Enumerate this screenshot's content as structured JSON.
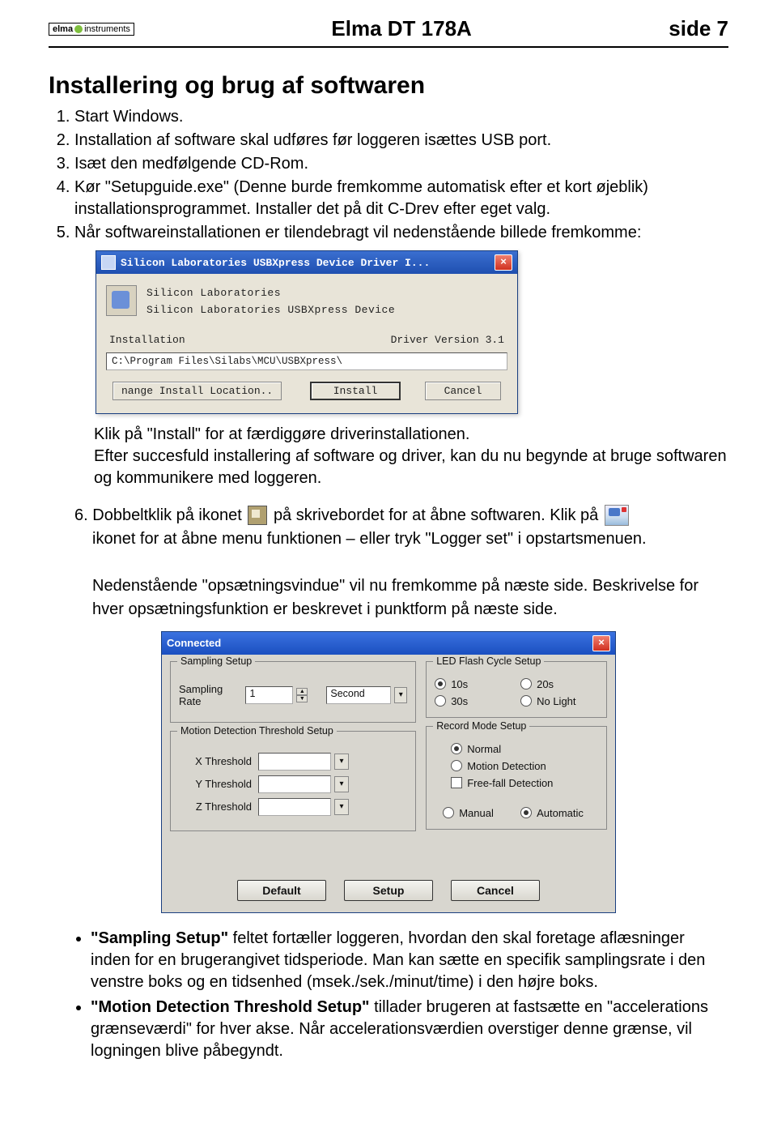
{
  "header": {
    "logo_text_left": "elma",
    "logo_text_right": "instruments",
    "title": "Elma DT 178A",
    "side": "side 7"
  },
  "section_title": "Installering og brug af softwaren",
  "steps": [
    "Start Windows.",
    "Installation af software skal udføres før loggeren isættes USB port.",
    "Isæt den medfølgende CD-Rom.",
    "Kør \"Setupguide.exe\" (Denne burde fremkomme automatisk efter et kort øjeblik) installationsprogrammet. Installer det på dit C-Drev efter eget valg.",
    "Når softwareinstallationen er tilendebragt vil nedenstående billede fremkomme:"
  ],
  "installer": {
    "title": "Silicon Laboratories USBXpress Device Driver I...",
    "line1": "Silicon Laboratories",
    "line2": "Silicon Laboratories USBXpress Device",
    "install_label": "Installation",
    "driver_version": "Driver Version 3.1",
    "path": "C:\\Program Files\\Silabs\\MCU\\USBXpress\\",
    "btn_change": "nange Install Location..",
    "btn_install": "Install",
    "btn_cancel": "Cancel"
  },
  "after_install": {
    "p1": "Klik på \"Install\" for at færdiggøre driverinstallationen.",
    "p2": "Efter succesfuld installering af software og driver, kan du nu begynde at bruge softwaren og kommunikere med loggeren."
  },
  "step6": {
    "num": "6.",
    "a": "Dobbeltklik på ikonet",
    "b": "på skrivebordet for at åbne softwaren. Klik på",
    "c": "ikonet for at åbne menu funktionen – eller tryk \"Logger set\" i opstartsmenuen.",
    "p2": "Nedenstående \"opsætningsvindue\" vil nu fremkomme på næste side. Beskrivelse for hver opsætningsfunktion er beskrevet i punktform på næste side."
  },
  "setup": {
    "title": "Connected",
    "sampling_legend": "Sampling Setup",
    "sampling_rate_label": "Sampling Rate",
    "sampling_rate_value": "1",
    "sampling_unit": "Second",
    "led_legend": "LED Flash Cycle Setup",
    "led_opts": [
      "10s",
      "20s",
      "30s",
      "No Light"
    ],
    "led_selected": 0,
    "motion_legend": "Motion Detection Threshold Setup",
    "x_label": "X Threshold",
    "y_label": "Y Threshold",
    "z_label": "Z Threshold",
    "record_legend": "Record Mode Setup",
    "record_opts": [
      "Normal",
      "Motion Detection"
    ],
    "record_selected": 0,
    "freefall_label": "Free-fall Detection",
    "mode_opts": [
      "Manual",
      "Automatic"
    ],
    "mode_selected": 1,
    "btn_default": "Default",
    "btn_setup": "Setup",
    "btn_cancel": "Cancel"
  },
  "bullets": {
    "b1": "\"Sampling Setup\" feltet fortæller loggeren, hvordan den skal foretage aflæsninger inden for en brugerangivet tidsperiode. Man kan sætte en specifik samplingsrate i den venstre boks og en tidsenhed (msek./sek./minut/time) i den højre boks.",
    "b2": "\"Motion Detection Threshold Setup\" tillader brugeren at fastsætte en \"accelerations grænseværdi\" for hver akse. Når accelerationsværdien overstiger denne grænse, vil logningen blive påbegyndt.",
    "b1_bold": "Sampling Setup",
    "b2_bold": "Motion Detection Threshold Setup"
  }
}
